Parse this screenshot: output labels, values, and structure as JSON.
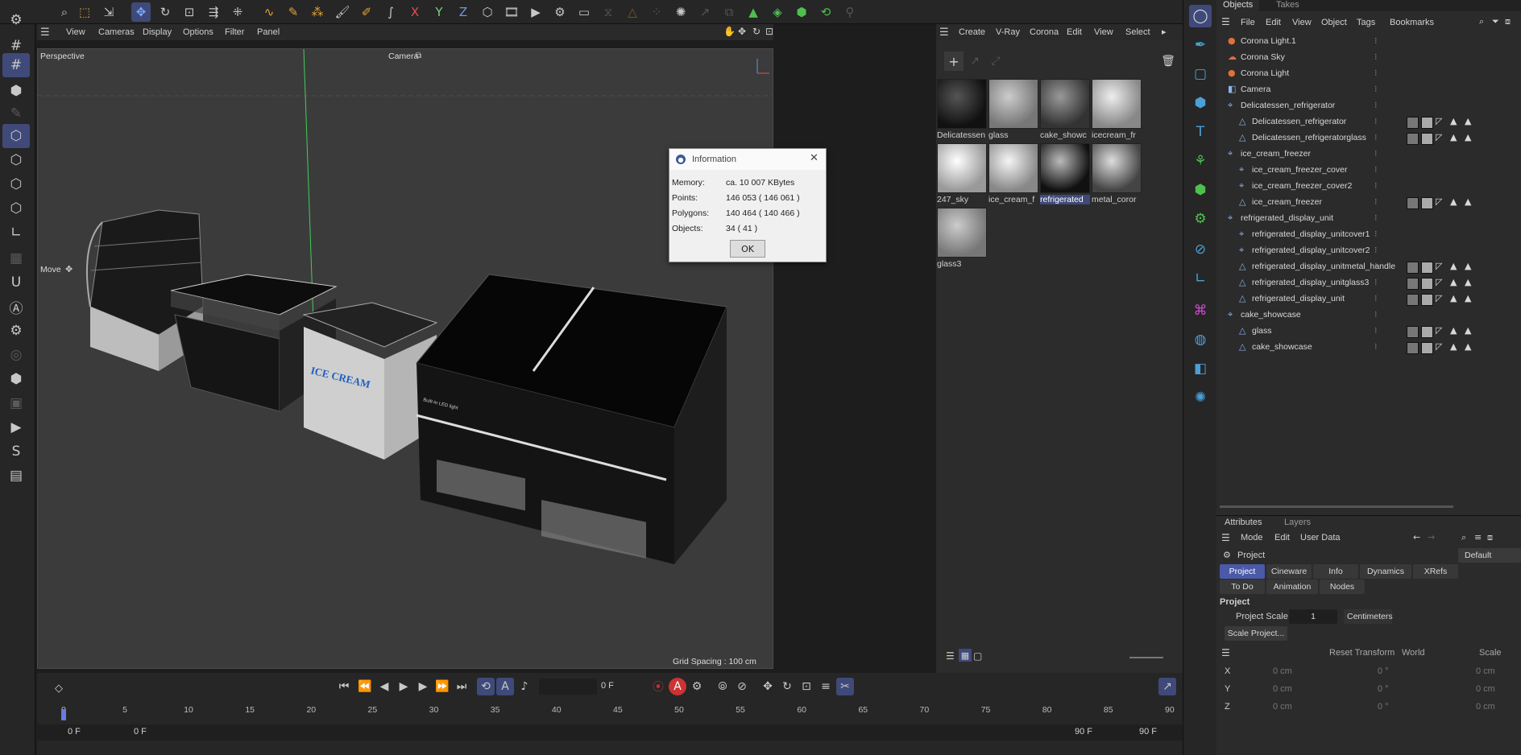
{
  "topbar": {
    "icons": [
      "search-icon",
      "selection-icon",
      "live-select-icon",
      "move-icon",
      "rotate-icon",
      "scale-icon",
      "snap-icon",
      "workplane-icon",
      "spline-icon",
      "spline-pen-icon",
      "brush-icon",
      "paint-icon",
      "sketch-icon",
      "axis-x-icon",
      "axis-y-icon",
      "axis-z-icon",
      "cube-icon",
      "render-region-icon",
      "render-icon",
      "render-settings-icon",
      "picture-viewer-icon",
      "lock-icon",
      "triangle-icon",
      "magic-icon",
      "arrow-icon",
      "mesh-icon",
      "cube-green-icon",
      "cube-white-icon",
      "deformer-icon",
      "bone-icon"
    ]
  },
  "viewport": {
    "menu": [
      "View",
      "Cameras",
      "Display",
      "Options",
      "Filter",
      "Panel"
    ],
    "label": "Perspective",
    "camera": "Camera",
    "tool": "Move",
    "grid_spacing": "Grid Spacing : 100 cm",
    "ice_cream_text": "ICE CREAM",
    "led_text": "Built-in LED light"
  },
  "dialog": {
    "title": "Information",
    "rows": [
      {
        "label": "Memory:",
        "value": "ca. 10 007 KBytes"
      },
      {
        "label": "Points:",
        "value": "146 053 ( 146 061 )"
      },
      {
        "label": "Polygons:",
        "value": "140 464 ( 140 466 )"
      },
      {
        "label": "Objects:",
        "value": "34 ( 41 )"
      }
    ],
    "ok": "OK"
  },
  "materials": {
    "menu": [
      "Create",
      "V-Ray",
      "Corona",
      "Edit",
      "View",
      "Select"
    ],
    "items": [
      {
        "name": "Delicatessen",
        "color": "#222"
      },
      {
        "name": "glass",
        "color": "#9a9a9a"
      },
      {
        "name": "cake_showc",
        "color": "#666"
      },
      {
        "name": "icecream_fr",
        "color": "#bdbdbd"
      },
      {
        "name": "247_sky",
        "color": "#dcdcdc"
      },
      {
        "name": "ice_cream_f",
        "color": "#cfcfcf"
      },
      {
        "name": "refrigerated",
        "color": "#2a2a2a"
      },
      {
        "name": "metal_coror",
        "color": "#888"
      },
      {
        "name": "glass3",
        "color": "#9a9a9a"
      }
    ],
    "selected_index": 6
  },
  "objects": {
    "tabs": [
      "Objects",
      "Takes"
    ],
    "menu": [
      "File",
      "Edit",
      "View",
      "Object",
      "Tags",
      "Bookmarks"
    ],
    "items": [
      {
        "name": "Corona Light.1",
        "indent": 0,
        "icon": "light-icon"
      },
      {
        "name": "Corona Sky",
        "indent": 0,
        "icon": "sky-icon"
      },
      {
        "name": "Corona Light",
        "indent": 0,
        "icon": "light-icon"
      },
      {
        "name": "Camera",
        "indent": 0,
        "icon": "camera-icon"
      },
      {
        "name": "Delicatessen_refrigerator",
        "indent": 0,
        "icon": "null-icon"
      },
      {
        "name": "Delicatessen_refrigerator",
        "indent": 1,
        "icon": "polygon-icon"
      },
      {
        "name": "Delicatessen_refrigeratorglass",
        "indent": 1,
        "icon": "polygon-icon"
      },
      {
        "name": "ice_cream_freezer",
        "indent": 0,
        "icon": "null-icon"
      },
      {
        "name": "ice_cream_freezer_cover",
        "indent": 1,
        "icon": "null-icon"
      },
      {
        "name": "ice_cream_freezer_cover2",
        "indent": 1,
        "icon": "null-icon"
      },
      {
        "name": "ice_cream_freezer",
        "indent": 1,
        "icon": "polygon-icon"
      },
      {
        "name": "refrigerated_display_unit",
        "indent": 0,
        "icon": "null-icon"
      },
      {
        "name": "refrigerated_display_unitcover1",
        "indent": 1,
        "icon": "null-icon"
      },
      {
        "name": "refrigerated_display_unitcover2",
        "indent": 1,
        "icon": "null-icon"
      },
      {
        "name": "refrigerated_display_unitmetal_handle",
        "indent": 1,
        "icon": "polygon-icon"
      },
      {
        "name": "refrigerated_display_unitglass3",
        "indent": 1,
        "icon": "polygon-icon"
      },
      {
        "name": "refrigerated_display_unit",
        "indent": 1,
        "icon": "polygon-icon"
      },
      {
        "name": "cake_showcase",
        "indent": 0,
        "icon": "null-icon"
      },
      {
        "name": "glass",
        "indent": 1,
        "icon": "polygon-icon"
      },
      {
        "name": "cake_showcase",
        "indent": 1,
        "icon": "polygon-icon"
      }
    ]
  },
  "attributes": {
    "tabs": [
      "Attributes",
      "Layers"
    ],
    "menu": [
      "Mode",
      "Edit",
      "User Data"
    ],
    "object": "Project",
    "preset": "Default",
    "subtabs": [
      "Project",
      "Cineware",
      "Info",
      "Dynamics",
      "XRefs",
      "To Do",
      "Animation",
      "Nodes"
    ],
    "section": "Project",
    "scale_label": "Project Scale",
    "scale_value": "1",
    "scale_unit": "Centimeters",
    "scale_btn": "Scale Project...",
    "coords_menu": [
      "Reset Transform",
      "World",
      "Scale"
    ],
    "axes": [
      "X",
      "Y",
      "Z"
    ],
    "pos": [
      "0 cm",
      "0 cm",
      "0 cm"
    ],
    "rot": [
      "0 °",
      "0 °",
      "0 °"
    ],
    "scl": [
      "0 cm",
      "0 cm",
      "0 cm"
    ]
  },
  "timeline": {
    "frame": "0 F",
    "start": "0 F",
    "start2": "0 F",
    "end": "90 F",
    "end2": "90 F",
    "ticks": [
      "0",
      "5",
      "10",
      "15",
      "20",
      "25",
      "30",
      "35",
      "40",
      "45",
      "50",
      "55",
      "60",
      "65",
      "70",
      "75",
      "80",
      "85",
      "90"
    ]
  }
}
